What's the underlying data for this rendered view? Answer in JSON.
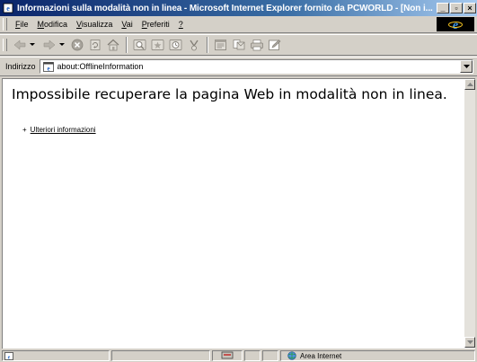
{
  "window": {
    "title": "Informazioni sulla modalità non in linea - Microsoft Internet Explorer fornito da PCWORLD - [Non i..."
  },
  "menu": {
    "items": [
      {
        "underline": "F",
        "rest": "ile"
      },
      {
        "underline": "M",
        "rest": "odifica"
      },
      {
        "underline": "V",
        "rest": "isualizza"
      },
      {
        "underline": "V",
        "rest": "ai"
      },
      {
        "underline": "P",
        "rest": "referiti"
      },
      {
        "underline": "?",
        "rest": ""
      }
    ]
  },
  "address": {
    "label": "Indirizzo",
    "value": "about:OfflineInformation"
  },
  "page": {
    "heading": "Impossibile recuperare la pagina Web in modalità non in linea.",
    "more_info_label": "Ulteriori informazioni"
  },
  "status": {
    "zone": "Area Internet"
  },
  "colors": {
    "titlebar_start": "#0a246a",
    "titlebar_end": "#a6caf0",
    "chrome": "#d4d0c8"
  }
}
